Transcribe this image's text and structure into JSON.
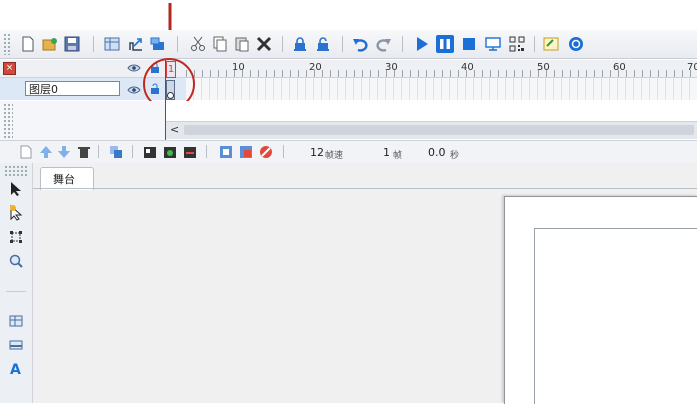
{
  "toolbar": {
    "icons": [
      "new-file-icon",
      "open-file-icon",
      "save-icon",
      "grid-icon",
      "export-icon",
      "import-icon",
      "cut-icon",
      "copy-icon",
      "paste-icon",
      "delete-icon",
      "lock-icon",
      "unlock-icon",
      "undo-icon",
      "redo-icon",
      "play-icon",
      "pause-icon",
      "stop-icon",
      "screen-icon",
      "qrcode-icon",
      "properties-icon",
      "help-icon"
    ]
  },
  "timeline": {
    "ruler": [
      "1",
      "10",
      "20",
      "30",
      "40",
      "50",
      "60",
      "70"
    ],
    "layer_name": "图层0",
    "scroll_arrow": "<"
  },
  "frame_bar": {
    "fps": "12",
    "fps_unit": "帧速",
    "frame": "1",
    "frame_unit": "帧",
    "time": "0.0",
    "time_unit": "秒"
  },
  "tabs": {
    "stage": "舞台"
  },
  "colors": {
    "accent_blue": "#1b6fd6",
    "annotation_red": "#c0281f",
    "playhead": "#e23b3b"
  }
}
